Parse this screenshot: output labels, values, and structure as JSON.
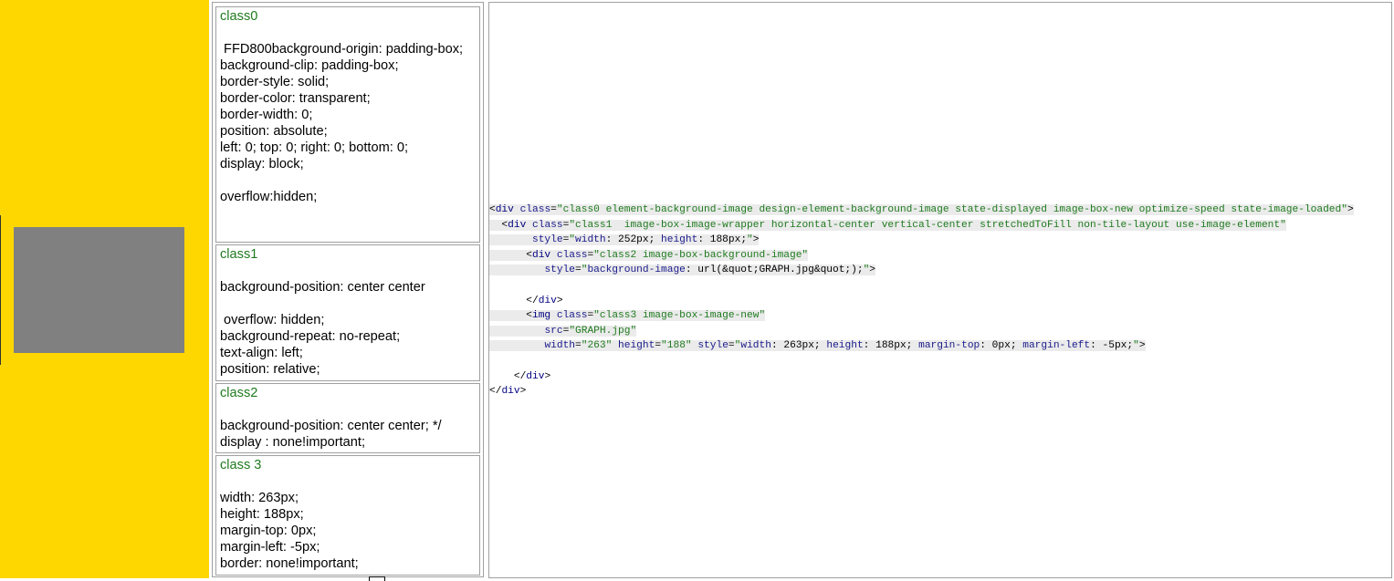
{
  "left_panel": {
    "background": "#FFD700",
    "image_placeholder_color": "#808080"
  },
  "css_cells": [
    {
      "title": "class0",
      "lines": [
        " FFD800background-origin: padding-box;",
        "background-clip: padding-box;",
        "border-style: solid;",
        "border-color: transparent;",
        "border-width: 0;",
        "position: absolute;",
        "left: 0; top: 0; right: 0; bottom: 0;",
        "display: block;",
        "",
        "overflow:hidden;"
      ]
    },
    {
      "title": "class1",
      "lines": [
        "background-position: center center",
        "",
        " overflow: hidden;",
        "background-repeat: no-repeat;",
        "text-align: left;",
        "position: relative;"
      ]
    },
    {
      "title": "class2",
      "lines": [
        "background-position: center center; */",
        "display : none!important;"
      ]
    },
    {
      "title": "class 3",
      "lines": [
        "width: 263px;",
        "height: 188px;",
        "margin-top: 0px;",
        "margin-left: -5px;",
        "border: none!important;"
      ]
    }
  ],
  "code_lines": [
    [
      [
        "sym",
        "<"
      ],
      [
        "tag",
        "div"
      ],
      [
        "sym",
        " "
      ],
      [
        "attr",
        "class"
      ],
      [
        "sym",
        "="
      ],
      [
        "str",
        "\"class0 element-background-image design-element-background-image state-displayed image-box-new optimize-speed state-image-loaded\""
      ],
      [
        "sym",
        ">"
      ]
    ],
    [
      [
        "sym",
        "  <"
      ],
      [
        "tag",
        "div"
      ],
      [
        "sym",
        " "
      ],
      [
        "attr",
        "class"
      ],
      [
        "sym",
        "="
      ],
      [
        "str",
        "\"class1  image-box-image-wrapper horizontal-center vertical-center stretchedToFill non-tile-layout use-image-element\""
      ]
    ],
    [
      [
        "sym",
        "       "
      ],
      [
        "attr",
        "style"
      ],
      [
        "sym",
        "="
      ],
      [
        "str",
        "\""
      ],
      [
        "attr",
        "width"
      ],
      [
        "sym",
        ": 252px; "
      ],
      [
        "attr",
        "height"
      ],
      [
        "sym",
        ": 188px;"
      ],
      [
        "str",
        "\""
      ],
      [
        "sym",
        ">"
      ]
    ],
    [
      [
        "sym",
        "      <"
      ],
      [
        "tag",
        "div"
      ],
      [
        "sym",
        " "
      ],
      [
        "attr",
        "class"
      ],
      [
        "sym",
        "="
      ],
      [
        "str",
        "\"class2 image-box-background-image\""
      ]
    ],
    [
      [
        "sym",
        "         "
      ],
      [
        "attr",
        "style"
      ],
      [
        "sym",
        "="
      ],
      [
        "str",
        "\""
      ],
      [
        "attr",
        "background-image"
      ],
      [
        "sym",
        ": url(&quot;GRAPH.jpg&quot;);"
      ],
      [
        "str",
        "\""
      ],
      [
        "sym",
        ">"
      ]
    ],
    [
      [
        "sym",
        ""
      ]
    ],
    [
      [
        "sym",
        "      </"
      ],
      [
        "tag",
        "div"
      ],
      [
        "sym",
        ">"
      ]
    ],
    [
      [
        "sym",
        "      <"
      ],
      [
        "tag",
        "img"
      ],
      [
        "sym",
        " "
      ],
      [
        "attr",
        "class"
      ],
      [
        "sym",
        "="
      ],
      [
        "str",
        "\"class3 image-box-image-new\""
      ]
    ],
    [
      [
        "sym",
        "         "
      ],
      [
        "attr",
        "src"
      ],
      [
        "sym",
        "="
      ],
      [
        "str",
        "\"GRAPH.jpg\""
      ]
    ],
    [
      [
        "sym",
        "         "
      ],
      [
        "attr",
        "width"
      ],
      [
        "sym",
        "="
      ],
      [
        "str",
        "\"263\""
      ],
      [
        "sym",
        " "
      ],
      [
        "attr",
        "height"
      ],
      [
        "sym",
        "="
      ],
      [
        "str",
        "\"188\""
      ],
      [
        "sym",
        " "
      ],
      [
        "attr",
        "style"
      ],
      [
        "sym",
        "="
      ],
      [
        "str",
        "\""
      ],
      [
        "attr",
        "width"
      ],
      [
        "sym",
        ": 263px; "
      ],
      [
        "attr",
        "height"
      ],
      [
        "sym",
        ": 188px; "
      ],
      [
        "attr",
        "margin-top"
      ],
      [
        "sym",
        ": 0px; "
      ],
      [
        "attr",
        "margin-left"
      ],
      [
        "sym",
        ": -5px;"
      ],
      [
        "str",
        "\""
      ],
      [
        "sym",
        ">"
      ]
    ],
    [
      [
        "sym",
        ""
      ]
    ],
    [
      [
        "sym",
        "    </"
      ],
      [
        "tag",
        "div"
      ],
      [
        "sym",
        ">"
      ]
    ],
    [
      [
        "sym",
        "</"
      ],
      [
        "tag",
        "div"
      ],
      [
        "sym",
        ">"
      ]
    ]
  ]
}
